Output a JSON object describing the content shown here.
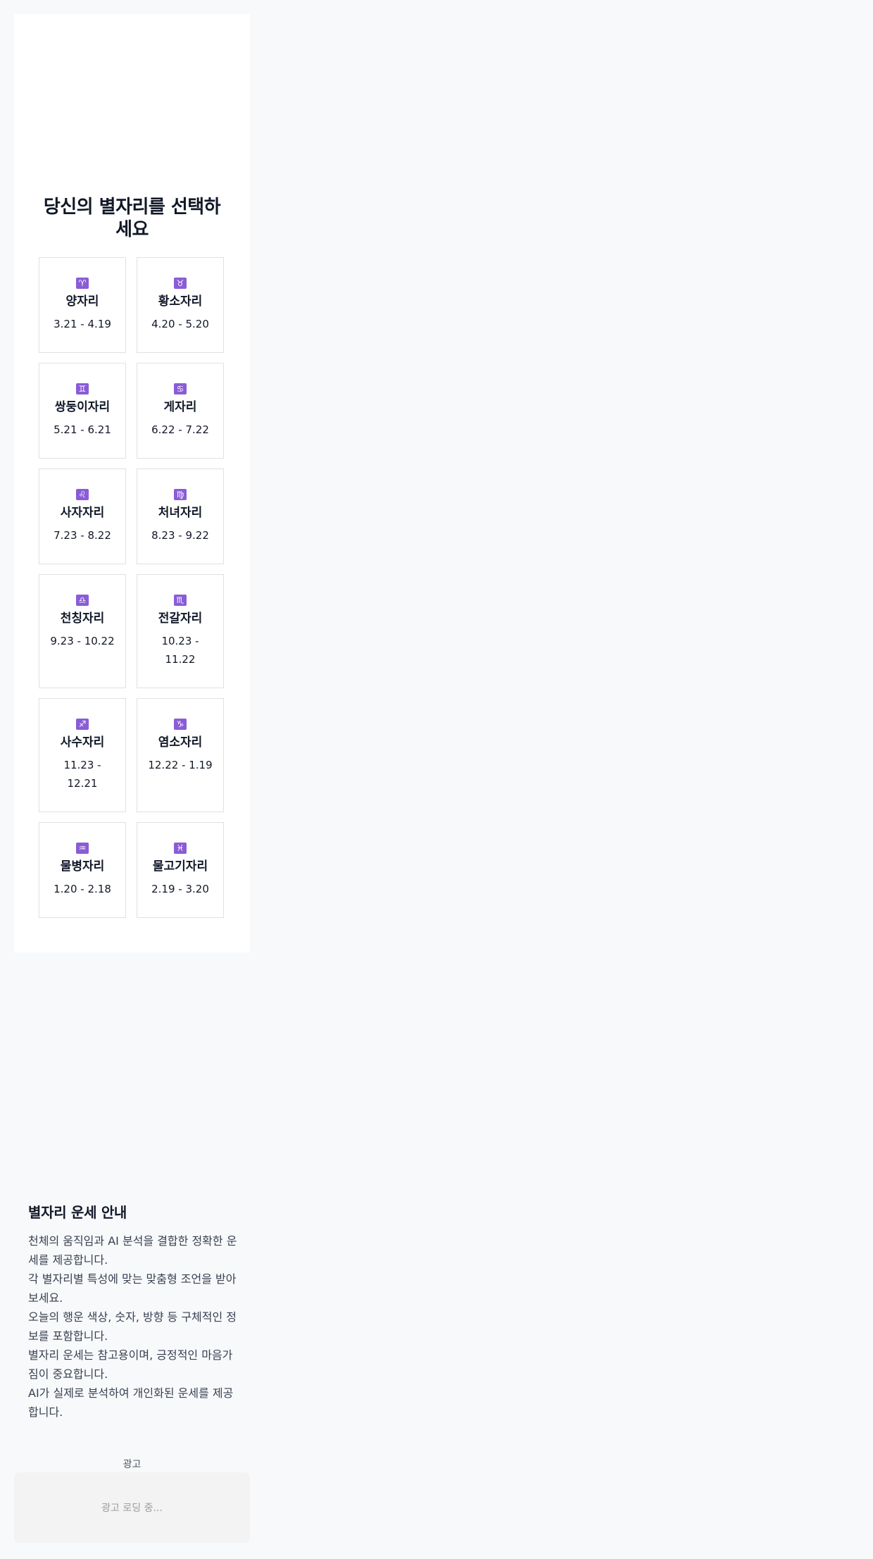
{
  "header": {
    "title_line1": "당신의 별자리를 선택하",
    "title_line2": "세요"
  },
  "zodiac": [
    {
      "symbol": "♈",
      "name": "양자리",
      "date": "3.21 - 4.19"
    },
    {
      "symbol": "♉",
      "name": "황소자리",
      "date": "4.20 - 5.20"
    },
    {
      "symbol": "♊",
      "name": "쌍둥이자리",
      "date": "5.21 - 6.21"
    },
    {
      "symbol": "♋",
      "name": "게자리",
      "date": "6.22 - 7.22"
    },
    {
      "symbol": "♌",
      "name": "사자자리",
      "date": "7.23 - 8.22"
    },
    {
      "symbol": "♍",
      "name": "처녀자리",
      "date": "8.23 - 9.22"
    },
    {
      "symbol": "♎",
      "name": "천칭자리",
      "date": "9.23 - 10.22"
    },
    {
      "symbol": "♏",
      "name": "전갈자리",
      "date": "10.23 - 11.22"
    },
    {
      "symbol": "♐",
      "name": "사수자리",
      "date": "11.23 - 12.21"
    },
    {
      "symbol": "♑",
      "name": "염소자리",
      "date": "12.22 - 1.19"
    },
    {
      "symbol": "♒",
      "name": "물병자리",
      "date": "1.20 - 2.18"
    },
    {
      "symbol": "♓",
      "name": "물고기자리",
      "date": "2.19 - 3.20"
    }
  ],
  "info": {
    "heading": "별자리 운세 안내",
    "items": [
      "천체의 움직임과 AI 분석을 결합한 정확한 운세를 제공합니다.",
      "각 별자리별 특성에 맞는 맞춤형 조언을 받아보세요.",
      "오늘의 행운 색상, 숫자, 방향 등 구체적인 정보를 포함합니다.",
      "별자리 운세는 참고용이며, 긍정적인 마음가짐이 중요합니다.",
      "AI가 실제로 분석하여 개인화된 운세를 제공합니다."
    ]
  },
  "ad": {
    "label": "광고",
    "loading": "광고 로딩 중..."
  },
  "colors": {
    "accent": "#8a5cd6",
    "background": "#f8f9fb",
    "card_border": "#dfe1e4"
  }
}
